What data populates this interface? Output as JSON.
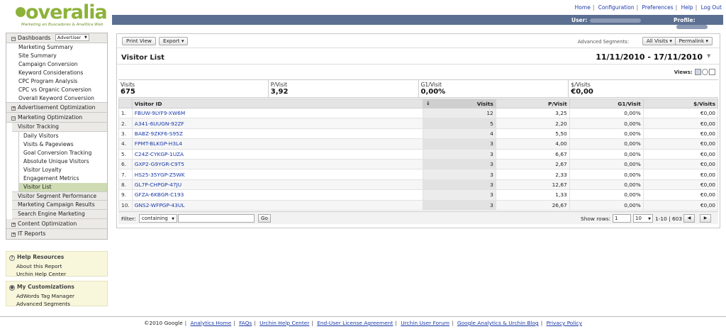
{
  "header": {
    "logo_text": "overalia",
    "logo_tagline": "Marketing en Buscadores & Analítica Web",
    "top_links": [
      "Home",
      "Configuration",
      "Preferences",
      "Help",
      "Log Out"
    ],
    "user_label": "User:",
    "profile_label": "Profile:"
  },
  "sidebar": {
    "dashboards_label": "Dashboards",
    "dashboards_select": "Advertiser",
    "dashboard_items": [
      "Marketing Summary",
      "Site Summary",
      "Campaign Conversion",
      "Keyword Considerations",
      "CPC Program Analysis",
      "CPC vs Organic Conversion",
      "Overall Keyword Conversion"
    ],
    "ad_opt": "Advertisement Optimization",
    "mkt_opt": "Marketing Optimization",
    "visitor_tracking": "Visitor Tracking",
    "vt_items": [
      "Daily Visitors",
      "Visits & Pageviews",
      "Goal Conversion Tracking",
      "Absolute Unique Visitors",
      "Visitor Loyalty",
      "Engagement Metrics",
      "Visitor List"
    ],
    "mkt_more": [
      "Visitor Segment Performance",
      "Marketing Campaign Results",
      "Search Engine Marketing"
    ],
    "content_opt": "Content Optimization",
    "it_reports": "IT Reports"
  },
  "help": {
    "title": "Help Resources",
    "items": [
      "About this Report",
      "Urchin Help Center"
    ]
  },
  "custom": {
    "title": "My Customizations",
    "items": [
      "AdWords Tag Manager",
      "Advanced Segments"
    ]
  },
  "toolbar": {
    "print": "Print View",
    "export": "Export ▾",
    "adv_seg_label": "Advanced Segments:",
    "all_visits": "All Visits ▾",
    "permalink": "Permalink ▾"
  },
  "report": {
    "title": "Visitor List",
    "date_range": "11/11/2010 - 17/11/2010",
    "views_label": "Views:"
  },
  "summary": [
    {
      "label": "Visits",
      "value": "675"
    },
    {
      "label": "P/Visit",
      "value": "3,92"
    },
    {
      "label": "G1/Visit",
      "value": "0,00%"
    },
    {
      "label": "$/Visits",
      "value": "€0,00"
    }
  ],
  "table": {
    "headers": [
      "Visitor ID",
      "Visits",
      "P/Visit",
      "G1/Visit",
      "$/Visits"
    ],
    "rows": [
      [
        "1.",
        "FBUW-9LYF9-XW6M",
        "12",
        "3,25",
        "0,00%",
        "€0,00"
      ],
      [
        "2.",
        "A341-6UUGN-92ZF",
        "5",
        "2,20",
        "0,00%",
        "€0,00"
      ],
      [
        "3.",
        "BABZ-9ZKF6-S95Z",
        "4",
        "5,50",
        "0,00%",
        "€0,00"
      ],
      [
        "4.",
        "FPMT-BLKGP-H3L4",
        "3",
        "4,00",
        "0,00%",
        "€0,00"
      ],
      [
        "5.",
        "C24Z-CYKGP-1UZA",
        "3",
        "6,67",
        "0,00%",
        "€0,00"
      ],
      [
        "6.",
        "GXP2-G9YGR-C9T5",
        "3",
        "2,67",
        "0,00%",
        "€0,00"
      ],
      [
        "7.",
        "HS25-35YGP-Z5WK",
        "3",
        "2,33",
        "0,00%",
        "€0,00"
      ],
      [
        "8.",
        "GL7P-CHPGP-47JU",
        "3",
        "12,67",
        "0,00%",
        "€0,00"
      ],
      [
        "9.",
        "GFZA-6KBGR-C193",
        "3",
        "1,33",
        "0,00%",
        "€0,00"
      ],
      [
        "10.",
        "GNS2-WFPGP-43UL",
        "3",
        "26,67",
        "0,00%",
        "€0,00"
      ]
    ]
  },
  "footer_bar": {
    "filter_label": "Filter:",
    "filter_mode": "containing",
    "go": "Go",
    "show_rows": "Show rows:",
    "start_row": "1",
    "rows_per_page": "10",
    "range": "1-10 | 603"
  },
  "bottom": {
    "copyright": "©2010 Google",
    "links": [
      "Analytics Home",
      "FAQs",
      "Urchin Help Center",
      "End-User License Agreement",
      "Urchin User Forum",
      "Google Analytics & Urchin Blog",
      "Privacy Policy"
    ]
  }
}
